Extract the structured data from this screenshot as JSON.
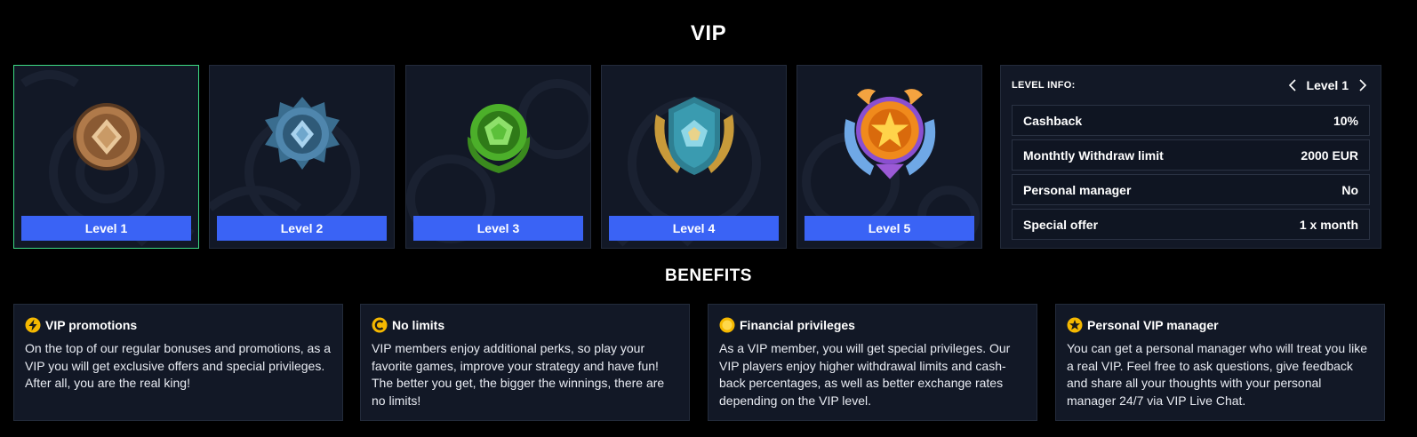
{
  "vip": {
    "title": "VIP",
    "levels": [
      {
        "label": "Level 1",
        "badge": "bronze-badge-icon",
        "color": "#b07a4a",
        "active": true
      },
      {
        "label": "Level 2",
        "badge": "steel-blue-badge-icon",
        "color": "#4f86ad",
        "active": false
      },
      {
        "label": "Level 3",
        "badge": "green-badge-icon",
        "color": "#4caf2a",
        "active": false
      },
      {
        "label": "Level 4",
        "badge": "teal-winged-badge-icon",
        "color": "#3a9bb0",
        "active": false
      },
      {
        "label": "Level 5",
        "badge": "gold-star-badge-icon",
        "color": "#f08a1c",
        "active": false
      }
    ]
  },
  "level_info": {
    "label": "LEVEL INFO:",
    "current": "Level 1",
    "rows": [
      {
        "name": "Cashback",
        "value": "10%"
      },
      {
        "name": "Monthtly Withdraw limit",
        "value": "2000 EUR"
      },
      {
        "name": "Personal manager",
        "value": "No"
      },
      {
        "name": "Special offer",
        "value": "1 x month"
      }
    ]
  },
  "benefits": {
    "title": "BENEFITS",
    "items": [
      {
        "icon": "lightning-icon",
        "title": "VIP promotions",
        "text": "On the top of our regular bonuses and promotions, as a VIP you will get exclusive offers and special privileges. After all, you are the real king!"
      },
      {
        "icon": "coin-c-icon",
        "title": "No limits",
        "text": "VIP members enjoy additional perks, so play your favorite games, improve your strategy and have fun! The better you get, the bigger the winnings, there are no limits!"
      },
      {
        "icon": "gold-coin-icon",
        "title": "Financial privileges",
        "text": "As a VIP member, you will get special privileges. Our VIP players enjoy higher withdrawal limits and cash-back percentages, as well as better exchange rates depending on the VIP level."
      },
      {
        "icon": "star-icon",
        "title": "Personal VIP manager",
        "text": "You can get a personal manager who will treat you like a real VIP. Feel free to ask questions, give feedback and share all your thoughts with your personal manager 24/7 via VIP Live Chat."
      }
    ]
  },
  "colors": {
    "accent_button": "#3a63f5",
    "active_border": "#3ddc84",
    "card_bg": "#121826",
    "icon_gold": "#f5b800"
  }
}
